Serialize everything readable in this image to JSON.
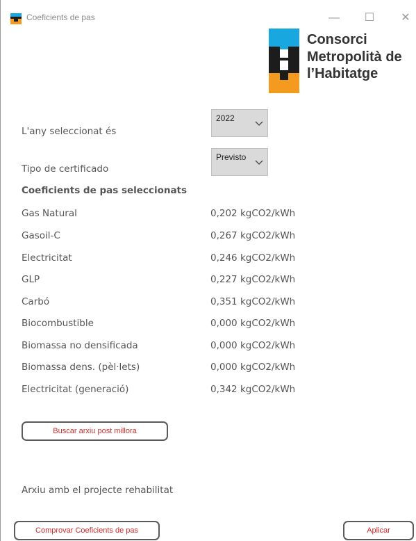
{
  "window": {
    "title": "Coeficients de pas",
    "minimize_glyph": "—",
    "maximize_glyph": "☐",
    "close_glyph": "✕"
  },
  "logo": {
    "line1": "Consorci",
    "line2": "Metropolità de",
    "line3": "l’Habitatge",
    "colors": {
      "blue": "#19a7e0",
      "orange": "#f39a1f",
      "dark": "#1c1c1c"
    }
  },
  "year": {
    "label": "L'any seleccionat és",
    "selected": "2022"
  },
  "certificate": {
    "label": "Tipo de certificado",
    "selected": "Previsto"
  },
  "coefficients": {
    "heading": "Coeficients de pas seleccionats",
    "rows": [
      {
        "name": "Gas Natural",
        "value": "0,202 kgCO2/kWh"
      },
      {
        "name": "Gasoil-C",
        "value": "0,267 kgCO2/kWh"
      },
      {
        "name": "Electricitat",
        "value": "0,246 kgCO2/kWh"
      },
      {
        "name": "GLP",
        "value": "0,227 kgCO2/kWh"
      },
      {
        "name": "Carbó",
        "value": "0,351 kgCO2/kWh"
      },
      {
        "name": "Biocombustible",
        "value": "0,000 kgCO2/kWh"
      },
      {
        "name": "Biomassa no densificada",
        "value": "0,000 kgCO2/kWh"
      },
      {
        "name": "Biomassa dens. (pèl·lets)",
        "value": "0,000 kgCO2/kWh"
      },
      {
        "name": "Electricitat (generació)",
        "value": "0,342 kgCO2/kWh"
      }
    ]
  },
  "buttons": {
    "search_file": "Buscar arxiu post millora",
    "check": "Comprovar Coeficients de pas",
    "apply": "Aplicar"
  },
  "file_label": "Arxiu amb el projecte rehabilitat",
  "colors": {
    "button_text": "#d02b2b",
    "select_bg": "#dadada"
  }
}
